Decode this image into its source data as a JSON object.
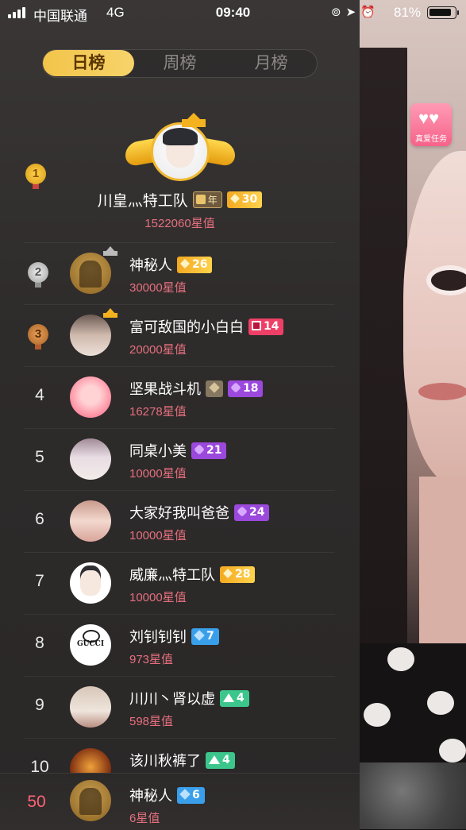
{
  "status_bar": {
    "carrier": "中国联通",
    "network": "4G",
    "time": "09:40",
    "battery": "81%"
  },
  "tabs": [
    "日榜",
    "周榜",
    "月榜"
  ],
  "active_tab": "日榜",
  "top1": {
    "rank": "1",
    "name": "川皇灬特工队",
    "badges": [
      {
        "type": "year",
        "text": "年"
      },
      {
        "type": "gold",
        "text": "30"
      }
    ],
    "score": "1522060星值"
  },
  "rows": [
    {
      "rank": "2",
      "name": "神秘人",
      "badge": {
        "type": "gold",
        "text": "26"
      },
      "score": "30000星值"
    },
    {
      "rank": "3",
      "name": "富可敌国的小白白",
      "badge": {
        "type": "red",
        "text": "14"
      },
      "score": "20000星值"
    },
    {
      "rank": "4",
      "name": "坚果战斗机",
      "badge": {
        "type": "purple",
        "text": "18"
      },
      "score": "16278星值"
    },
    {
      "rank": "5",
      "name": "同桌小美",
      "badge": {
        "type": "purple",
        "text": "21"
      },
      "score": "10000星值"
    },
    {
      "rank": "6",
      "name": "大家好我叫爸爸",
      "badge": {
        "type": "purple",
        "text": "24"
      },
      "score": "10000星值"
    },
    {
      "rank": "7",
      "name": "威廉灬特工队",
      "badge": {
        "type": "gold",
        "text": "28"
      },
      "score": "10000星值"
    },
    {
      "rank": "8",
      "name": "刘钊钊钊",
      "badge": {
        "type": "blue",
        "text": "7"
      },
      "score": "973星值"
    },
    {
      "rank": "9",
      "name": "川川丶肾以虚",
      "badge": {
        "type": "green",
        "text": "4"
      },
      "score": "598星值"
    },
    {
      "rank": "10",
      "name": "该川秋裤了",
      "badge": {
        "type": "green",
        "text": "4"
      },
      "score": ""
    }
  ],
  "avatar_text_gucci": "GUCCI",
  "my_rank": {
    "rank": "50",
    "name": "神秘人",
    "badge": {
      "type": "blue",
      "text": "6"
    },
    "score": "6星值"
  },
  "side_task": {
    "label": "真爱任务"
  },
  "colors": {
    "accent_gold": "#f2c44a",
    "score_pink": "#e5707e",
    "my_rank_red": "#ff6475"
  }
}
